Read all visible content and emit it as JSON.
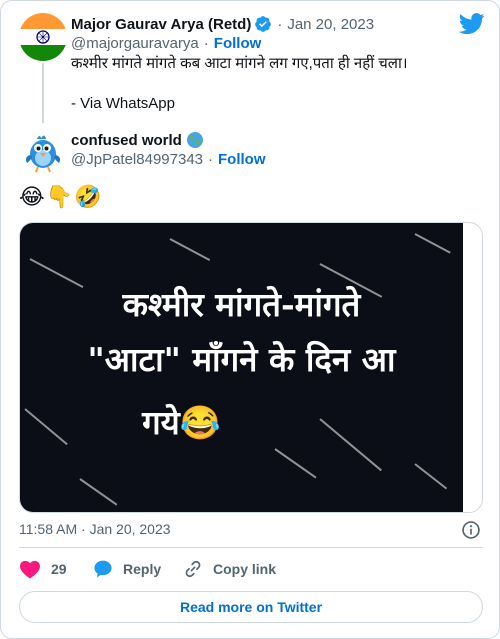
{
  "tweet": {
    "author_name": "Major Gaurav Arya (Retd)",
    "author_handle": "@majorgauravarya",
    "date": "Jan 20, 2023",
    "follow_label": "Follow",
    "text": "कश्मीर मांगते मांगते कब आटा मांगने लग गए,पता ही नहीं चला।\n\n- Via WhatsApp"
  },
  "quoted": {
    "author_name": "confused world",
    "author_handle": "@JpPatel84997343",
    "follow_label": "Follow",
    "emojis": "😂👇🤣"
  },
  "media": {
    "line1": "कश्मीर मांगते-मांगते",
    "line2": "\"आटा\" माँगने के दिन आ",
    "line3": "गये😂"
  },
  "footer": {
    "time": "11:58 AM",
    "date": "Jan 20, 2023",
    "likes": "29",
    "reply_label": "Reply",
    "copy_label": "Copy link",
    "read_more_label": "Read more on Twitter"
  },
  "colors": {
    "accent": "#006fd6",
    "twitter_blue": "#1d9bf0",
    "like_red": "#f91880",
    "muted": "#536471",
    "image_bg": "#0b0e16"
  },
  "icons": [
    "india-flag-avatar",
    "verified-badge-icon",
    "twitter-bird-icon",
    "globe-emoji-icon",
    "bird-avatar",
    "info-icon",
    "heart-icon",
    "reply-bubble-icon",
    "link-icon"
  ]
}
